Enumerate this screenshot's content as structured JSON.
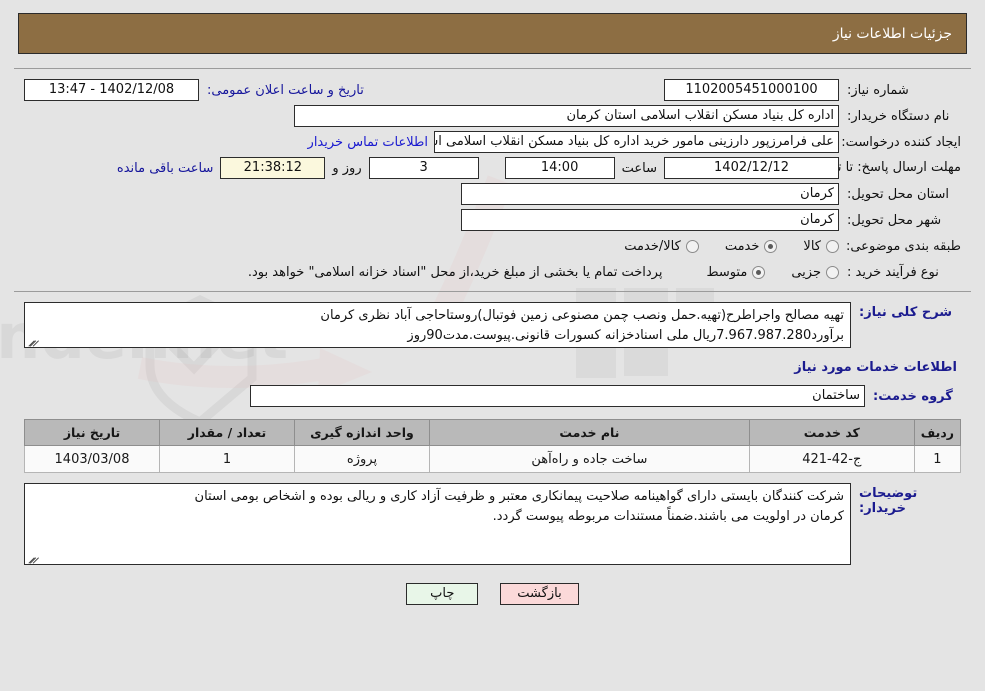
{
  "header": {
    "title": "جزئیات اطلاعات نیاز"
  },
  "form": {
    "need_number": {
      "label": "شماره نیاز:",
      "value": "1102005451000100"
    },
    "announce_datetime": {
      "label": "تاریخ و ساعت اعلان عمومی:",
      "value": "1402/12/08 - 13:47"
    },
    "buyer_org": {
      "label": "نام دستگاه خریدار:",
      "value": "اداره کل بنیاد مسکن انقلاب اسلامی استان کرمان"
    },
    "creator": {
      "label": "ایجاد کننده درخواست:",
      "value": "علی فرامرزپور دارزینی مامور خرید اداره کل بنیاد مسکن انقلاب اسلامی استان ک",
      "contact_link": "اطلاعات تماس خریدار"
    },
    "deadline": {
      "label": "مهلت ارسال پاسخ: تا تاریخ:",
      "date": "1402/12/12",
      "clock_label": "ساعت",
      "clock": "14:00",
      "days": "3",
      "days_label": "روز و",
      "remaining": "21:38:12",
      "remaining_label": "ساعت باقی مانده"
    },
    "province": {
      "label": "استان محل تحویل:",
      "value": "کرمان"
    },
    "city": {
      "label": "شهر محل تحویل:",
      "value": "کرمان"
    },
    "category": {
      "label": "طبقه بندی موضوعی:",
      "options": [
        {
          "label": "کالا",
          "selected": false
        },
        {
          "label": "خدمت",
          "selected": true
        },
        {
          "label": "کالا/خدمت",
          "selected": false
        }
      ]
    },
    "process_type": {
      "label": "نوع فرآیند خرید :",
      "options": [
        {
          "label": "جزیی",
          "selected": false
        },
        {
          "label": "متوسط",
          "selected": true
        }
      ],
      "note": "پرداخت تمام یا بخشی از مبلغ خرید،از محل \"اسناد خزانه اسلامی\" خواهد بود."
    }
  },
  "description": {
    "label": "شرح کلی نیاز:",
    "line1": "تهیه مصالح واجراطرح(تهیه.حمل ونصب چمن مصنوعی زمین فوتبال)روستاحاجی آباد نظری کرمان",
    "line2": "برآورد7.967.987.280ریال ملی اسنادخزانه کسورات قانونی.پیوست.مدت90روز"
  },
  "services_section": {
    "title": "اطلاعات خدمات مورد نیاز",
    "service_group": {
      "label": "گروه خدمت:",
      "value": "ساختمان"
    },
    "table": {
      "columns": [
        "ردیف",
        "کد خدمت",
        "نام خدمت",
        "واحد اندازه گیری",
        "تعداد / مقدار",
        "تاریخ نیاز"
      ],
      "rows": [
        {
          "radif": "1",
          "code": "ج-42-421",
          "name": "ساخت جاده و راه‌آهن",
          "unit": "پروژه",
          "qty": "1",
          "date": "1403/03/08"
        }
      ]
    }
  },
  "buyer_notes": {
    "label": "توضیحات خریدار:",
    "line1": "شرکت کنندگان بایستی دارای گواهینامه صلاحیت پیمانکاری معتبر و ظرفیت آزاد کاری و ریالی بوده و اشخاص بومی استان",
    "line2": "کرمان در اولویت می باشند.ضمناً مستندات مربوطه پیوست گردد."
  },
  "footer": {
    "print_label": "چاپ",
    "back_label": "بازگشت"
  },
  "colors": {
    "header_bg": "#8d6e43",
    "link": "#1a1ad0",
    "section_heading": "#1b1b8f",
    "countdown_bg": "#fbf8dd",
    "print_btn_bg": "#e8f6e8",
    "back_btn_bg": "#fbd9d9",
    "table_header_bg": "#b9b9b9",
    "page_bg": "#e4e4e4"
  }
}
